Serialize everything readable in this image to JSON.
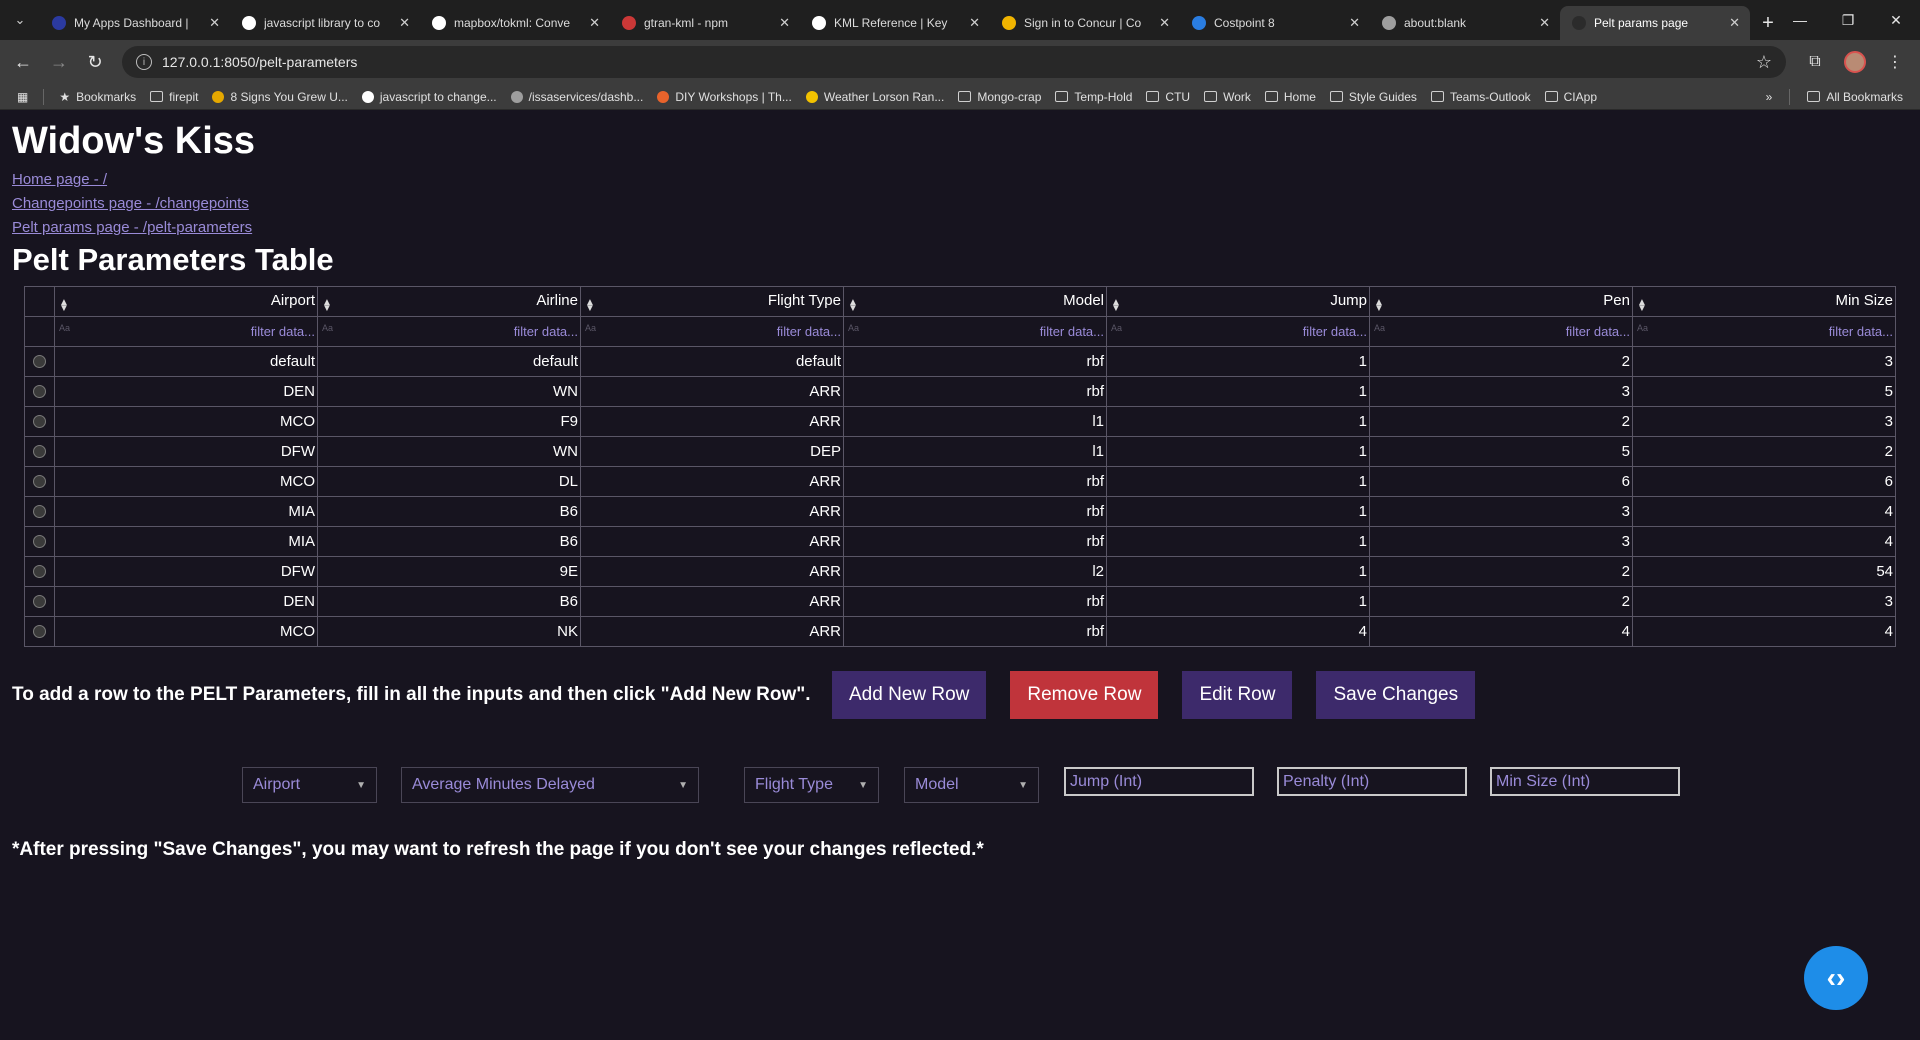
{
  "browser": {
    "tabs": [
      {
        "title": "My Apps Dashboard | ",
        "color": "#2b3aa0",
        "active": false
      },
      {
        "title": "javascript library to co",
        "color": "#ffffff",
        "active": false
      },
      {
        "title": "mapbox/tokml: Conve",
        "color": "#ffffff",
        "active": false
      },
      {
        "title": "gtran-kml - npm",
        "color": "#cb3837",
        "active": false
      },
      {
        "title": "KML Reference | Key",
        "color": "#ffffff",
        "active": false
      },
      {
        "title": "Sign in to Concur | Co",
        "color": "#f0b400",
        "active": false
      },
      {
        "title": "Costpoint 8",
        "color": "#2a7de1",
        "active": false
      },
      {
        "title": "about:blank",
        "color": "#9e9e9e",
        "active": false
      },
      {
        "title": "Pelt params page",
        "color": "#2b2b2b",
        "active": true
      }
    ],
    "url": "127.0.0.1:8050/pelt-parameters",
    "bookmarks": [
      {
        "label": "Bookmarks",
        "kind": "star"
      },
      {
        "label": "firepit",
        "kind": "folder"
      },
      {
        "label": "8 Signs You Grew U...",
        "kind": "dot",
        "color": "#e5a800"
      },
      {
        "label": "javascript to change...",
        "kind": "dot",
        "color": "#ffffff"
      },
      {
        "label": "/issaservices/dashb...",
        "kind": "dot",
        "color": "#9e9e9e"
      },
      {
        "label": "DIY Workshops | Th...",
        "kind": "dot",
        "color": "#e8632b"
      },
      {
        "label": "Weather Lorson Ran...",
        "kind": "dot",
        "color": "#f2c200"
      },
      {
        "label": "Mongo-crap",
        "kind": "folder"
      },
      {
        "label": "Temp-Hold",
        "kind": "folder"
      },
      {
        "label": "CTU",
        "kind": "folder"
      },
      {
        "label": "Work",
        "kind": "folder"
      },
      {
        "label": "Home",
        "kind": "folder"
      },
      {
        "label": "Style Guides",
        "kind": "folder"
      },
      {
        "label": "Teams-Outlook",
        "kind": "folder"
      },
      {
        "label": "CIApp",
        "kind": "folder"
      }
    ],
    "all_bookmarks": "All Bookmarks",
    "more_bookmarks": "»"
  },
  "page": {
    "title": "Widow's Kiss",
    "links": [
      "Home page - /",
      "Changepoints page - /changepoints",
      "Pelt params page - /pelt-parameters"
    ],
    "table_title": "Pelt Parameters Table"
  },
  "table": {
    "columns": [
      "Airport",
      "Airline",
      "Flight Type",
      "Model",
      "Jump",
      "Pen",
      "Min Size"
    ],
    "filter_placeholder": "filter data...",
    "filter_case_icon": "Aa",
    "rows": [
      [
        "default",
        "default",
        "default",
        "rbf",
        "1",
        "2",
        "3"
      ],
      [
        "DEN",
        "WN",
        "ARR",
        "rbf",
        "1",
        "3",
        "5"
      ],
      [
        "MCO",
        "F9",
        "ARR",
        "l1",
        "1",
        "2",
        "3"
      ],
      [
        "DFW",
        "WN",
        "DEP",
        "l1",
        "1",
        "5",
        "2"
      ],
      [
        "MCO",
        "DL",
        "ARR",
        "rbf",
        "1",
        "6",
        "6"
      ],
      [
        "MIA",
        "B6",
        "ARR",
        "rbf",
        "1",
        "3",
        "4"
      ],
      [
        "MIA",
        "B6",
        "ARR",
        "rbf",
        "1",
        "3",
        "4"
      ],
      [
        "DFW",
        "9E",
        "ARR",
        "l2",
        "1",
        "2",
        "54"
      ],
      [
        "DEN",
        "B6",
        "ARR",
        "rbf",
        "1",
        "2",
        "3"
      ],
      [
        "MCO",
        "NK",
        "ARR",
        "rbf",
        "4",
        "4",
        "4"
      ]
    ]
  },
  "actions": {
    "hint": "To add a row to the PELT Parameters, fill in all the inputs and then click \"Add New Row\".",
    "add_label": "Add New Row",
    "remove_label": "Remove Row",
    "edit_label": "Edit Row",
    "save_label": "Save Changes"
  },
  "inputs": {
    "airport": "Airport",
    "metric": "Average Minutes Delayed",
    "flight_type": "Flight Type",
    "model": "Model",
    "jump_placeholder": "Jump (Int)",
    "penalty_placeholder": "Penalty (Int)",
    "min_size_placeholder": "Min Size (Int)"
  },
  "footnote": "*After pressing \"Save Changes\", you may want to refresh the page if you don't see your changes reflected.*",
  "colors": {
    "background": "#17141f",
    "accent_purple": "#3d2a6b",
    "danger_red": "#c0343b",
    "link": "#9a8bd8",
    "fab_blue": "#1e8de8"
  }
}
